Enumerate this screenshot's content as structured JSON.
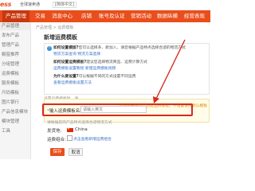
{
  "header": {
    "logo": "ess",
    "logo_sub": "全球速卖通",
    "language": "[简体中文]"
  },
  "nav": {
    "items": [
      "产品管理",
      "交易",
      "消息中心",
      "店铺",
      "账号及认证",
      "营销活动",
      "数据纵横",
      "经营表现"
    ],
    "active_index": 0,
    "accent": "#e94e1b"
  },
  "sidebar": {
    "items": [
      "产品管理",
      "发布产品",
      "管理产品",
      "橱窗推荐",
      "分组管理",
      "运费模板",
      "服务模板",
      "尺码模板",
      "图片银行",
      "产品信息模块",
      "模块管理",
      "工具"
    ]
  },
  "main": {
    "breadcrumb": "产品管理 > 运费模板",
    "title": "新增运费模板",
    "help": {
      "icon": "info-icon",
      "line1_q": "如何设置模版?",
      "line1_a": "您可以选择多、新加入、请您根据产品特点选择合适的物流方式",
      "line2_links": [
        "物流方案查询",
        "物流方案选择"
      ],
      "line3_q": "如何设置运费模板?",
      "line3_a": "建议您选择物流商品、运费计算方式",
      "line4_links": [
        "运费模板设置教程",
        "新建运费模板视频"
      ],
      "line5_q": "为什么要设置?",
      "line5_a": "可以根据不同的方式设置不同运费",
      "line6_link": "查看运费模板设置方法"
    },
    "note": "设置运费模板时，请",
    "hint": "您目前最多可以创建运费模板，不设置使用默认模板"
  },
  "form": {
    "template_name_label": "输入运费模板名称:",
    "template_name_required": "*",
    "template_name_placeholder": "请输入英文",
    "template_name_hint": "请根据您的产品特点选择合适物流方式",
    "origin_label": "发货地:",
    "origin_value": "China",
    "cargo_label": "运费组合:",
    "cargo_link": "点击查看新增运费组合"
  },
  "buttons": {
    "save": "保存",
    "cancel": "取消"
  },
  "annotation_color": "#d62a1f"
}
